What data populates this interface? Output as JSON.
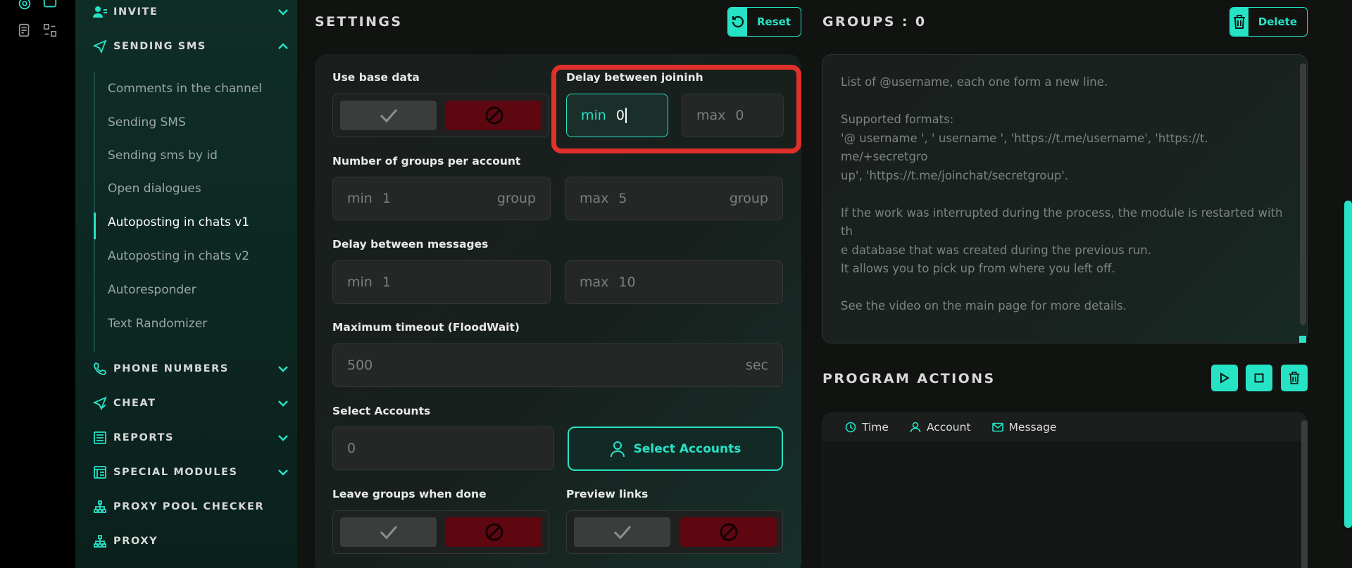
{
  "sidebar": {
    "sections": [
      {
        "title": "INVITE",
        "icon": "user-plus-icon",
        "expanded": false
      },
      {
        "title": "SENDING SMS",
        "icon": "send-icon",
        "expanded": true
      },
      {
        "title": "PHONE NUMBERS",
        "icon": "phone-icon",
        "expanded": false
      },
      {
        "title": "CHEAT",
        "icon": "send-check-icon",
        "expanded": false
      },
      {
        "title": "REPORTS",
        "icon": "report-icon",
        "expanded": false
      },
      {
        "title": "SPECIAL MODULES",
        "icon": "modules-icon",
        "expanded": false
      },
      {
        "title": "PROXY POOL CHECKER",
        "icon": "network-icon"
      },
      {
        "title": "PROXY",
        "icon": "network-icon"
      }
    ],
    "sms_items": [
      "Comments in the channel",
      "Sending SMS",
      "Sending sms by id",
      "Open dialogues",
      "Autoposting in chats v1",
      "Autoposting in chats v2",
      "Autoresponder",
      "Text Randomizer"
    ],
    "active_item": "Autoposting in chats v1"
  },
  "settings": {
    "title": "SETTINGS",
    "reset_label": "Reset",
    "use_base_data_label": "Use base data",
    "delay_joining": {
      "label": "Delay between joininh",
      "min_prefix": "min",
      "min_value": "0",
      "max_prefix": "max",
      "max_value": "0"
    },
    "groups_per_account": {
      "label": "Number of groups per account",
      "min_prefix": "min",
      "min_value": "1",
      "max_prefix": "max",
      "max_value": "5",
      "unit": "group"
    },
    "delay_messages": {
      "label": "Delay between messages",
      "min_prefix": "min",
      "min_value": "1",
      "max_prefix": "max",
      "max_value": "10"
    },
    "max_timeout": {
      "label": "Maximum timeout (FloodWait)",
      "value": "500",
      "unit": "sec"
    },
    "select_accounts": {
      "label": "Select Accounts",
      "value": "0",
      "button_label": "Select Accounts"
    },
    "leave_groups_label": "Leave groups when done",
    "preview_links_label": "Preview links"
  },
  "groups": {
    "title": "GROUPS : 0",
    "delete_label": "Delete",
    "placeholder": "List of @username, each one form a new line.\n\nSupported formats:\n'@ username ', ' username ', 'https://t.me/username', 'https://t. me/+secretgro\nup', 'https://t.me/joinchat/secretgroup'.\n\nIf the work was interrupted during the process, the module is restarted with th\ne database that was created during the previous run.\nIt allows you to pick up from where you left off.\n\nSee the video on the main page for more details."
  },
  "program_actions": {
    "title": "PROGRAM ACTIONS",
    "columns": [
      "Time",
      "Account",
      "Message"
    ]
  },
  "colors": {
    "accent": "#27e3c6",
    "danger": "#5e0710",
    "highlight": "#e0302c"
  }
}
